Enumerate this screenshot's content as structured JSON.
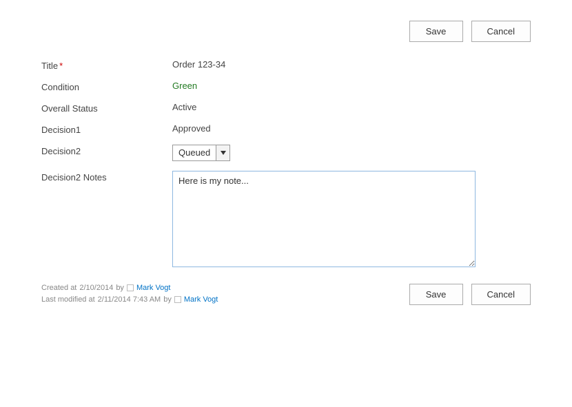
{
  "actions": {
    "save": "Save",
    "cancel": "Cancel"
  },
  "fields": {
    "title": {
      "label": "Title",
      "value": "Order 123-34",
      "required": true
    },
    "condition": {
      "label": "Condition",
      "value": "Green"
    },
    "overallStatus": {
      "label": "Overall Status",
      "value": "Active"
    },
    "decision1": {
      "label": "Decision1",
      "value": "Approved"
    },
    "decision2": {
      "label": "Decision2",
      "value": "Queued"
    },
    "decision2Notes": {
      "label": "Decision2 Notes",
      "value": "Here is my note..."
    }
  },
  "meta": {
    "createdPrefix": "Created at ",
    "createdDate": "2/10/2014",
    "createdBy": " by ",
    "createdUser": "Mark Vogt",
    "modifiedPrefix": "Last modified at ",
    "modifiedDate": "2/11/2014 7:43 AM",
    "modifiedBy": " by ",
    "modifiedUser": "Mark Vogt"
  }
}
